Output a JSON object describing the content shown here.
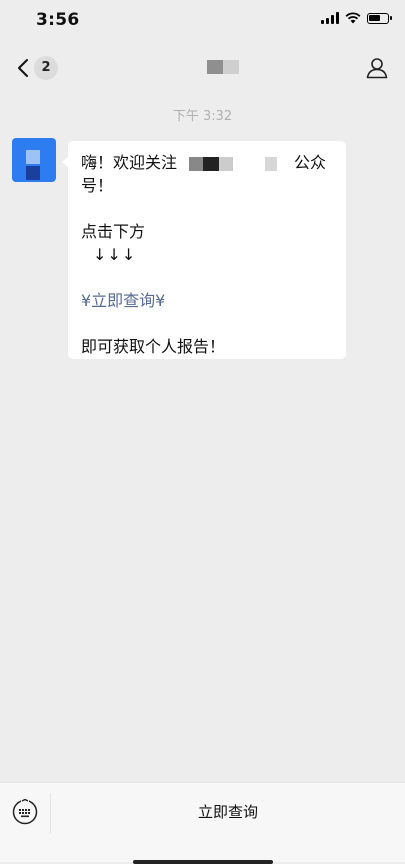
{
  "status_bar": {
    "time": "3:56"
  },
  "nav": {
    "unread_count": "2"
  },
  "chat": {
    "timestamp": "下午 3:32",
    "message": {
      "line1_start": "嗨！欢迎关注",
      "line1_end": "公众",
      "line2": "号！",
      "line3": "点击下方",
      "line4": "↓↓↓",
      "link_text": "¥立即查询¥",
      "line6": "即可获取个人报告！"
    }
  },
  "bottom_menu": {
    "button_label": "立即查询"
  },
  "colors": {
    "link": "#576b95",
    "avatar": "#2e7df0",
    "background": "#ededed"
  }
}
